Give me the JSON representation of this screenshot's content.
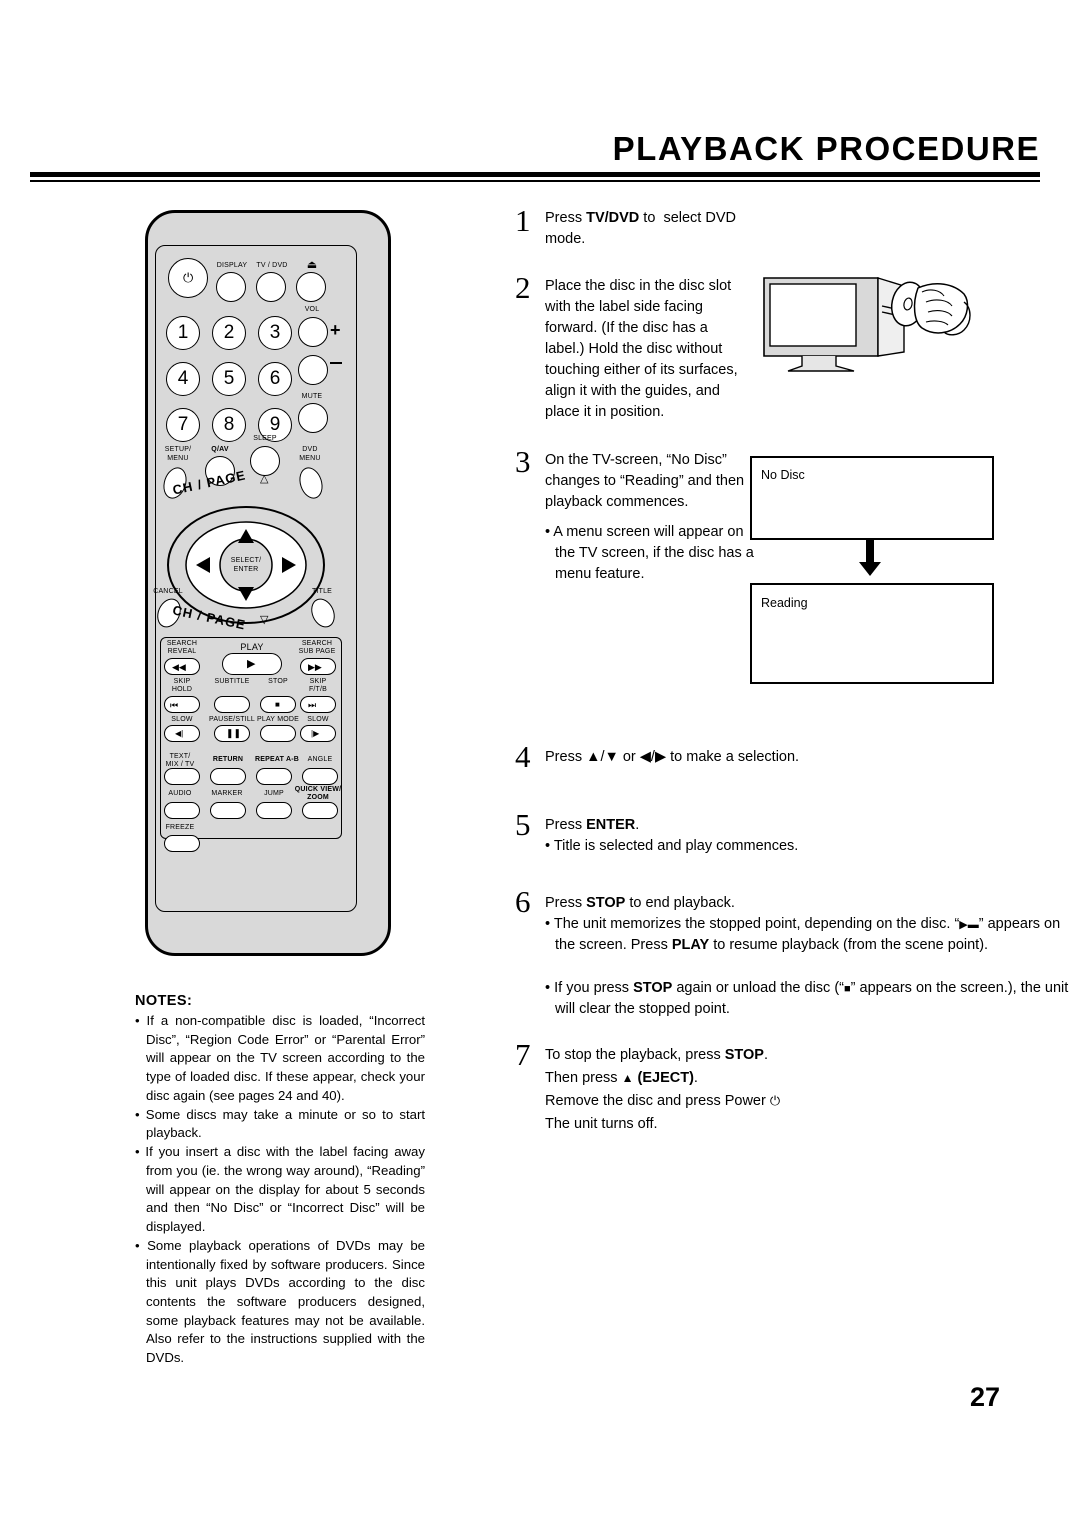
{
  "header": {
    "title": "PLAYBACK PROCEDURE"
  },
  "page_number": "27",
  "steps": [
    {
      "num": "1",
      "text": "Press TV/DVD to select DVD mode.",
      "parts": [
        {
          "t": "Press ",
          "b": false
        },
        {
          "t": "TV/DVD",
          "b": true
        },
        {
          "t": " to select DVD mode.",
          "b": false
        }
      ]
    },
    {
      "num": "2",
      "text": "Place the disc in the disc slot with the label side facing forward. (If the disc has a label.) Hold the disc without touching either of its surfaces, align it with the guides, and place it in position."
    },
    {
      "num": "3",
      "text": "On the TV-screen, “No Disc” changes to “Reading” and then playback commences.",
      "bullet": "• A menu screen will appear on the TV screen, if the disc has a menu feature."
    },
    {
      "num": "4",
      "text": "Press ▲/▼ or ◀/▶ to make a selection."
    },
    {
      "num": "5",
      "text": "Press ENTER.",
      "bullet": "• Title is selected and play commences."
    },
    {
      "num": "6",
      "text": "Press STOP to end playback.",
      "bullet1": "• The unit memorizes the stopped point, depending on the disc. “ ” appears on the screen. Press PLAY to resume playback (from the scene point).",
      "bullet2": "• If you press STOP again or unload the disc (“ ” appears on the screen.), the unit will clear the stopped point."
    },
    {
      "num": "7",
      "line1": "To stop the playback, press STOP.",
      "line2": "Then press  (EJECT).",
      "line3": "Remove the disc and press Power",
      "line4": "The unit turns off."
    }
  ],
  "tv_screens": {
    "first": "No Disc",
    "second": "Reading"
  },
  "notes": {
    "heading": "NOTES:",
    "items": [
      "• If a non-compatible disc is loaded, “Incorrect Disc”, “Region Code Error” or “Parental Error” will appear on the TV screen according to the type of loaded disc. If these appear, check your disc again (see pages 24 and 40).",
      "• Some discs may take a minute or so to start playback.",
      "• If you insert a disc with the label facing away from you (ie. the wrong way around), “Reading” will appear on the display for about 5 seconds and then “No Disc” or “Incorrect Disc” will be displayed.",
      "• Some playback operations of DVDs may be intentionally fixed by software producers. Since this unit plays DVDs according to the disc contents the software producers designed, some playback features may not be available. Also refer to the instructions supplied with the DVDs."
    ]
  },
  "remote": {
    "labels": {
      "display": "DISPLAY",
      "tvdvd": "TV / DVD",
      "eject": "⏏",
      "vol": "VOL",
      "volplus": "+",
      "volminus": "–",
      "mute": "MUTE",
      "sleep": "SLEEP",
      "setup_menu_1": "SETUP/",
      "setup_menu_2": "MENU",
      "qav": "Q/AV",
      "dvd_menu_1": "DVD",
      "dvd_menu_2": "MENU",
      "ch_page_up": "CH / PAGE",
      "ch_page_down": "CH / PAGE",
      "select_1": "SELECT/",
      "select_2": "ENTER",
      "cancel": "CANCEL",
      "title": "TITLE",
      "search_reveal_1": "SEARCH",
      "search_reveal_2": "REVEAL",
      "play": "PLAY",
      "search_subpage_1": "SEARCH",
      "search_subpage_2": "SUB PAGE",
      "skip_hold_1": "SKIP",
      "skip_hold_2": "HOLD",
      "subtitle": "SUBTITLE",
      "stop": "STOP",
      "skip_ftb_1": "SKIP",
      "skip_ftb_2": "F/T/B",
      "slow_left": "SLOW",
      "pause_still": "PAUSE/STILL",
      "play_mode": "PLAY MODE",
      "slow_right": "SLOW",
      "text_1": "TEXT/",
      "text_2": "MIX / TV",
      "return": "RETURN",
      "repeat": "REPEAT A-B",
      "angle": "ANGLE",
      "audio": "AUDIO",
      "marker": "MARKER",
      "jump": "JUMP",
      "quickview_1": "QUICK VIEW/",
      "quickview_2": "ZOOM",
      "freeze": "FREEZE"
    },
    "numbers": [
      "1",
      "2",
      "3",
      "4",
      "5",
      "6",
      "7",
      "8",
      "9"
    ]
  }
}
